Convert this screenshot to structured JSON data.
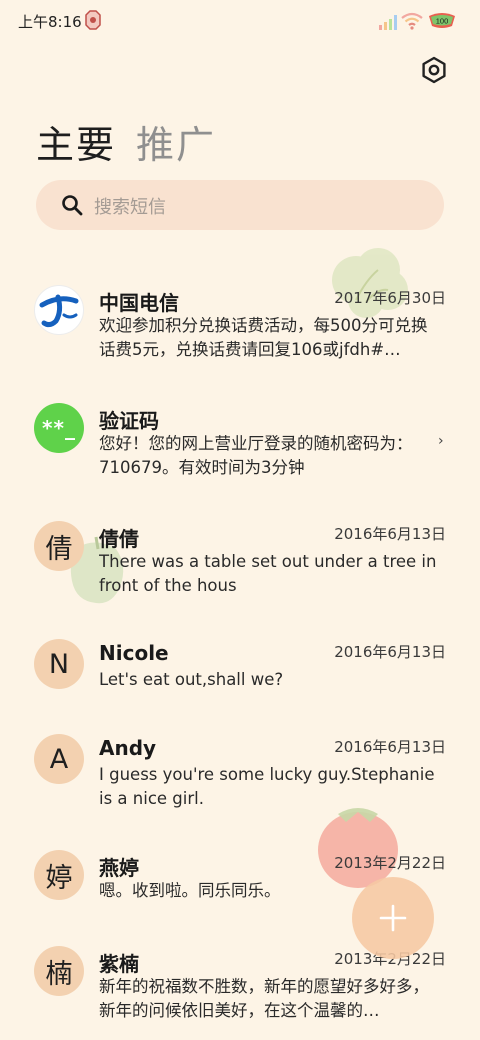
{
  "status_bar": {
    "time": "上午8:16",
    "battery": "100"
  },
  "tabs": {
    "main": "主要",
    "promo": "推广"
  },
  "search": {
    "placeholder": "搜索短信"
  },
  "conversations": [
    {
      "sender": "中国电信",
      "date": "2017年6月30日",
      "preview": "欢迎参加积分兑换话费活动，每500分可兑换话费5元，兑换话费请回复106或jfdh#…",
      "avatar_type": "telecom-logo"
    },
    {
      "sender": "验证码",
      "date": "",
      "preview": "您好！您的网上营业厅登录的随机密码为：710679。有效时间为3分钟",
      "avatar_text": "**_",
      "chevron": "›"
    },
    {
      "sender": "倩倩",
      "date": "2016年6月13日",
      "preview": "There was a table set out under a tree in front of the hous",
      "avatar_text": "倩"
    },
    {
      "sender": "Nicole",
      "date": "2016年6月13日",
      "preview": "Let's eat out,shall we?",
      "avatar_text": "N"
    },
    {
      "sender": "Andy",
      "date": "2016年6月13日",
      "preview": "I guess you're some lucky guy.Stephanie is a nice girl.",
      "avatar_text": "A"
    },
    {
      "sender": "燕婷",
      "date": "2013年2月22日",
      "preview": "嗯。收到啦。同乐同乐。",
      "avatar_text": "婷"
    },
    {
      "sender": "紫楠",
      "date": "2013年2月22日",
      "preview": "新年的祝福数不胜数，新年的愿望好多好多，新年的问候依旧美好，在这个温馨的…",
      "avatar_text": "楠"
    }
  ],
  "colors": {
    "background": "#fdf4e6",
    "search_bg": "#f9e2d0",
    "avatar_bg": "#f3d1b0",
    "code_avatar": "#5fd24a",
    "fab": "#f6c8a3",
    "telecom_blue": "#1560bd"
  },
  "icons": {
    "settings": "gear-icon",
    "search": "search-icon",
    "fab": "plus-icon"
  }
}
